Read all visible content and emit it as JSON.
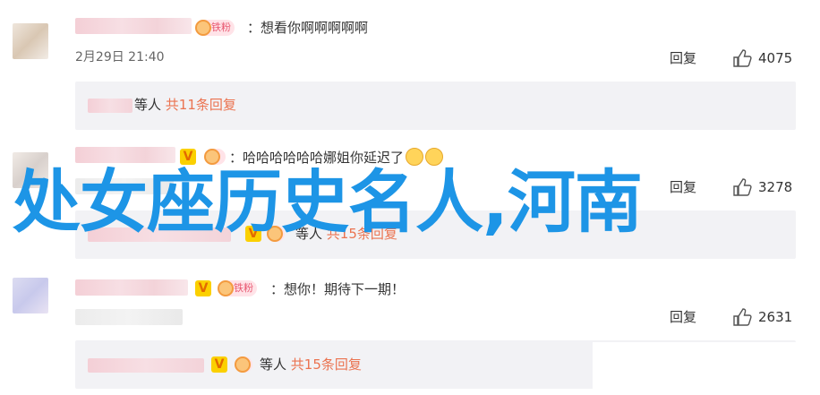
{
  "comments": [
    {
      "badge_label": "铁粉",
      "text": "：想看你啊啊啊啊啊",
      "time": "2月29日 21:40",
      "reply_label": "回复",
      "like_count": "4075",
      "replies_prefix": "等人",
      "replies_count": "共11条回复"
    },
    {
      "badge_label": "铁粉",
      "text": "：哈哈哈哈哈哈娜姐你延迟了",
      "reply_label": "回复",
      "like_count": "3278",
      "replies_prefix": "等人",
      "replies_count": "共15条回复"
    },
    {
      "badge_label": "铁粉",
      "text": "：想你！期待下一期！",
      "reply_label": "回复",
      "like_count": "2631",
      "replies_prefix": "等人",
      "replies_count": "共15条回复"
    }
  ],
  "overlay_title": "处女座历史名人,河南",
  "colors": {
    "overlay": "#1d95e6",
    "reply_count": "#eb7350",
    "fan_badge": "#e8566f"
  },
  "icons": [
    "thumbs-up-icon",
    "vip-v-icon",
    "fan-pig-icon",
    "emoji-icon"
  ]
}
